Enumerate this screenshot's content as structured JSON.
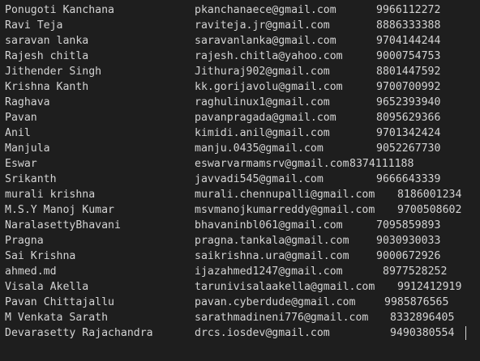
{
  "rows": [
    {
      "name": "Ponugoti Kanchana",
      "email": "pkanchanaece@gmail.com",
      "phone": "9966112272",
      "phone_col": 464
    },
    {
      "name": "Ravi Teja",
      "email": "raviteja.jr@gmail.com",
      "phone": "8886333388",
      "phone_col": 464
    },
    {
      "name": "saravan lanka",
      "email": "saravanlanka@gmail.com",
      "phone": "9704144244",
      "phone_col": 464
    },
    {
      "name": "Rajesh chitla",
      "email": "rajesh.chitla@yahoo.com",
      "phone": "9000754753",
      "phone_col": 464
    },
    {
      "name": "Jithender Singh",
      "email": "Jithuraj902@gmail.com",
      "phone": "8801447592",
      "phone_col": 464
    },
    {
      "name": "Krishna Kanth",
      "email": "kk.gorijavolu@gmail.com",
      "phone": "9700700992",
      "phone_col": 464
    },
    {
      "name": "Raghava",
      "email": "raghulinux1@gmail.com",
      "phone": "9652393940",
      "phone_col": 464
    },
    {
      "name": "Pavan",
      "email": "pavanpragada@gmail.com",
      "phone": "8095629366",
      "phone_col": 464
    },
    {
      "name": "Anil",
      "email": "kimidi.anil@gmail.com",
      "phone": "9701342424",
      "phone_col": 464
    },
    {
      "name": "Manjula",
      "email": "manju.0435@gmail.com",
      "phone": "9052267730",
      "phone_col": 464
    },
    {
      "name": "Eswar",
      "email": "eswarvarmamsrv@gmail.com",
      "phone": "8374111188",
      "phone_col": 431
    },
    {
      "name": "Srikanth",
      "email": "javvadi545@gmail.com",
      "phone": "9666643339",
      "phone_col": 464
    },
    {
      "name": "murali krishna",
      "email": "murali.chennupalli@gmail.com",
      "phone": "8186001234",
      "phone_col": 490
    },
    {
      "name": "M.S.Y Manoj Kumar",
      "email": "msvmanojkumarreddy@gmail.com",
      "phone": "9700508602",
      "phone_col": 490
    },
    {
      "name": "NaralasettyBhavani",
      "email": "bhavaninbl061@gmail.com",
      "phone": "7095859893",
      "phone_col": 464
    },
    {
      "name": "Pragna",
      "email": "pragna.tankala@gmail.com",
      "phone": "9030930033",
      "phone_col": 464
    },
    {
      "name": "Sai Krishna",
      "email": "saikrishna.ura@gmail.com",
      "phone": "9000672926",
      "phone_col": 464
    },
    {
      "name": "ahmed.md",
      "email": "ijazahmed1247@gmail.com",
      "phone": "8977528252",
      "phone_col": 472
    },
    {
      "name": "Visala Akella",
      "email": "tarunivisalaakella@gmail.com",
      "phone": "9912412919",
      "phone_col": 490
    },
    {
      "name": "Pavan Chittajallu",
      "email": "pavan.cyberdude@gmail.com",
      "phone": "9985876565",
      "phone_col": 474
    },
    {
      "name": "M Venkata Sarath",
      "email": "sarathmadineni776@gmail.com",
      "phone": "8332896405",
      "phone_col": 481
    },
    {
      "name": "Devarasetty Rajachandra",
      "email": "drcs.iosdev@gmail.com",
      "phone": "9490380554",
      "phone_col": 481
    }
  ]
}
